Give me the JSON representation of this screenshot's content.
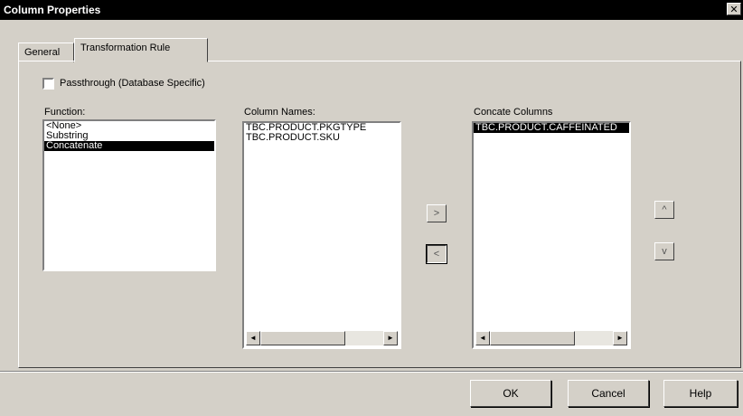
{
  "window": {
    "title": "Column Properties",
    "close_glyph": "✕"
  },
  "tabs": [
    {
      "label": "General"
    },
    {
      "label": "Transformation Rule"
    }
  ],
  "passthrough": {
    "label": "Passthrough (Database Specific)",
    "checked": false
  },
  "function_list": {
    "label": "Function:",
    "items": [
      "<None>",
      "Substring",
      "Concatenate"
    ],
    "selected": "Concatenate"
  },
  "column_names": {
    "label": "Column Names:",
    "items": [
      "TBC.PRODUCT.PKGTYPE",
      "TBC.PRODUCT.SKU"
    ]
  },
  "concat_columns": {
    "label": "Concate Columns",
    "items": [
      "TBC.PRODUCT.CAFFEINATED"
    ],
    "selected": "TBC.PRODUCT.CAFFEINATED"
  },
  "transfer": {
    "add": ">",
    "remove": "<"
  },
  "order": {
    "up": "^",
    "down": "v"
  },
  "scroll": {
    "left": "◄",
    "right": "►"
  },
  "buttons": {
    "ok": "OK",
    "cancel": "Cancel",
    "help": "Help"
  }
}
